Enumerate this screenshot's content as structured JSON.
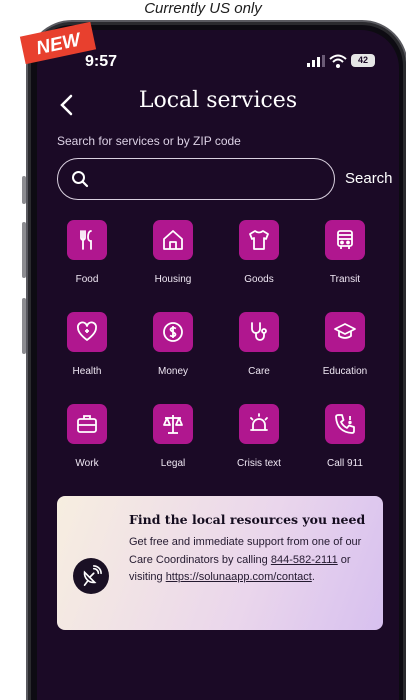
{
  "caption": "Currently US only",
  "badge": "NEW",
  "status_bar": {
    "time": "9:57",
    "battery": "42"
  },
  "header": {
    "title": "Local services"
  },
  "search": {
    "label": "Search for services or by ZIP code",
    "placeholder": "",
    "button_label": "Search"
  },
  "services": [
    {
      "label": "Food",
      "icon": "fork-knife-icon"
    },
    {
      "label": "Housing",
      "icon": "house-icon"
    },
    {
      "label": "Goods",
      "icon": "shirt-icon"
    },
    {
      "label": "Transit",
      "icon": "bus-icon"
    },
    {
      "label": "Health",
      "icon": "heart-icon"
    },
    {
      "label": "Money",
      "icon": "dollar-icon"
    },
    {
      "label": "Care",
      "icon": "stethoscope-icon"
    },
    {
      "label": "Education",
      "icon": "graduation-cap-icon"
    },
    {
      "label": "Work",
      "icon": "briefcase-icon"
    },
    {
      "label": "Legal",
      "icon": "scales-icon"
    },
    {
      "label": "Crisis text",
      "icon": "alarm-icon"
    },
    {
      "label": "Call 911",
      "icon": "phone-icon"
    }
  ],
  "info_card": {
    "title": "Find the local resources you need",
    "body_prefix": "Get free and immediate support from one of our Care Coordinators by calling ",
    "phone": "844-582-2111",
    "body_middle": " or visiting ",
    "link": "https://solunaapp.com/contact",
    "body_suffix": "."
  },
  "colors": {
    "background": "#1b0a26",
    "tile": "#b0178f",
    "badge": "#e8402e"
  }
}
